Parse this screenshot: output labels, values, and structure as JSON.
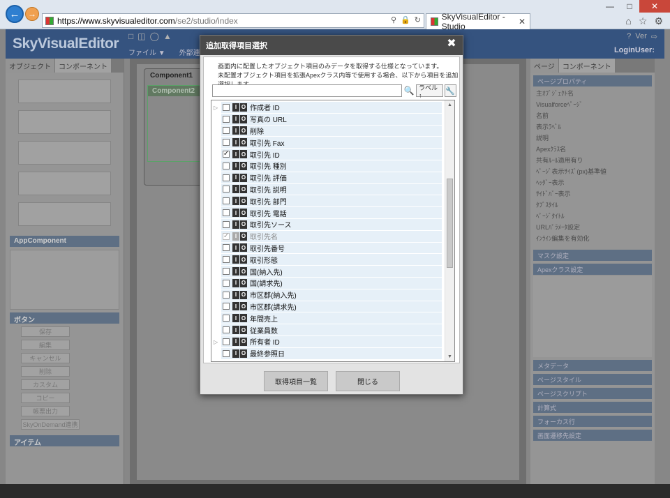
{
  "browser": {
    "url_host": "https://www.skyvisualeditor.com",
    "url_path": "/se2/studio/index",
    "tab_title": "SkyVisualEditor - Studio"
  },
  "app": {
    "logo": "SkyVisualEditor",
    "menu": [
      "ファイル ▼",
      "外部連携"
    ],
    "login": "LoginUser:",
    "left_tabs": [
      "オブジェクト",
      "コンポーネント"
    ],
    "left_sections": [
      "AppComponent",
      "ボタン",
      "アイテム"
    ],
    "left_buttons": [
      "保存",
      "編集",
      "キャンセル",
      "削除",
      "カスタム",
      "コピー",
      "帳票出力",
      "SkyOnDemand連携"
    ],
    "canvas_title": "Component1",
    "canvas_sub": "Component2",
    "right_tabs": [
      "ページ",
      "コンポーネント"
    ],
    "right_section": "ページプロパティ",
    "right_rows": [
      "主ｵﾌﾞｼﾞｪｸﾄ名",
      "Visualforceﾍﾟｰｼﾞ",
      "名前",
      "表示ﾗﾍﾞﾙ",
      "説明",
      "Apexｸﾗｽ名",
      "共有ﾙｰﾙ適用有り",
      "ﾍﾟｰｼﾞ表示ｻｲｽﾞ(px)基準値",
      "ﾍｯﾀﾞｰ表示",
      "ｻｲﾄﾞﾊﾞｰ表示",
      "ﾀﾌﾞｽﾀｲﾙ",
      "ﾍﾟｰｼﾞﾀｲﾄﾙ",
      "URLﾊﾟﾗﾒｰﾀ設定",
      "ｲﾝﾗｲﾝ編集を有効化"
    ],
    "right_sections2": [
      "マスク設定",
      "Apexクラス設定",
      "メタデータ",
      "ページスタイル",
      "ページスクリプト",
      "計算式",
      "フォーカス行",
      "画面遷移先設定"
    ]
  },
  "modal": {
    "title": "追加取得項目選択",
    "desc_line1": "画面内に配置したオブジェクト項目のみデータを取得する仕様となっています。",
    "desc_line2": "未配置オブジェクト項目を拡張Apexクラス内等で使用する場合、以下から項目を追加選択します。",
    "search_value": "",
    "label_btn": "ラベル↑",
    "items": [
      {
        "label": "作成者 ID",
        "checked": false,
        "expandable": true,
        "disabled": false
      },
      {
        "label": "写真の URL",
        "checked": false,
        "expandable": false,
        "disabled": false
      },
      {
        "label": "削除",
        "checked": false,
        "expandable": false,
        "disabled": false
      },
      {
        "label": "取引先 Fax",
        "checked": false,
        "expandable": false,
        "disabled": false
      },
      {
        "label": "取引先 ID",
        "checked": true,
        "expandable": false,
        "disabled": false
      },
      {
        "label": "取引先 種別",
        "checked": false,
        "expandable": false,
        "disabled": false
      },
      {
        "label": "取引先 評価",
        "checked": false,
        "expandable": false,
        "disabled": false
      },
      {
        "label": "取引先 説明",
        "checked": false,
        "expandable": false,
        "disabled": false
      },
      {
        "label": "取引先 部門",
        "checked": false,
        "expandable": false,
        "disabled": false
      },
      {
        "label": "取引先 電話",
        "checked": false,
        "expandable": false,
        "disabled": false
      },
      {
        "label": "取引先ソース",
        "checked": false,
        "expandable": false,
        "disabled": false
      },
      {
        "label": "取引先名",
        "checked": true,
        "expandable": false,
        "disabled": true
      },
      {
        "label": "取引先番号",
        "checked": false,
        "expandable": false,
        "disabled": false
      },
      {
        "label": "取引形態",
        "checked": false,
        "expandable": false,
        "disabled": false
      },
      {
        "label": "国(納入先)",
        "checked": false,
        "expandable": false,
        "disabled": false
      },
      {
        "label": "国(請求先)",
        "checked": false,
        "expandable": false,
        "disabled": false
      },
      {
        "label": "市区郡(納入先)",
        "checked": false,
        "expandable": false,
        "disabled": false
      },
      {
        "label": "市区郡(請求先)",
        "checked": false,
        "expandable": false,
        "disabled": false
      },
      {
        "label": "年間売上",
        "checked": false,
        "expandable": false,
        "disabled": false
      },
      {
        "label": "従業員数",
        "checked": false,
        "expandable": false,
        "disabled": false
      },
      {
        "label": "所有者 ID",
        "checked": false,
        "expandable": true,
        "disabled": false
      },
      {
        "label": "最終参照日",
        "checked": false,
        "expandable": false,
        "disabled": false
      }
    ],
    "btn_list": "取得項目一覧",
    "btn_close": "閉じる"
  }
}
